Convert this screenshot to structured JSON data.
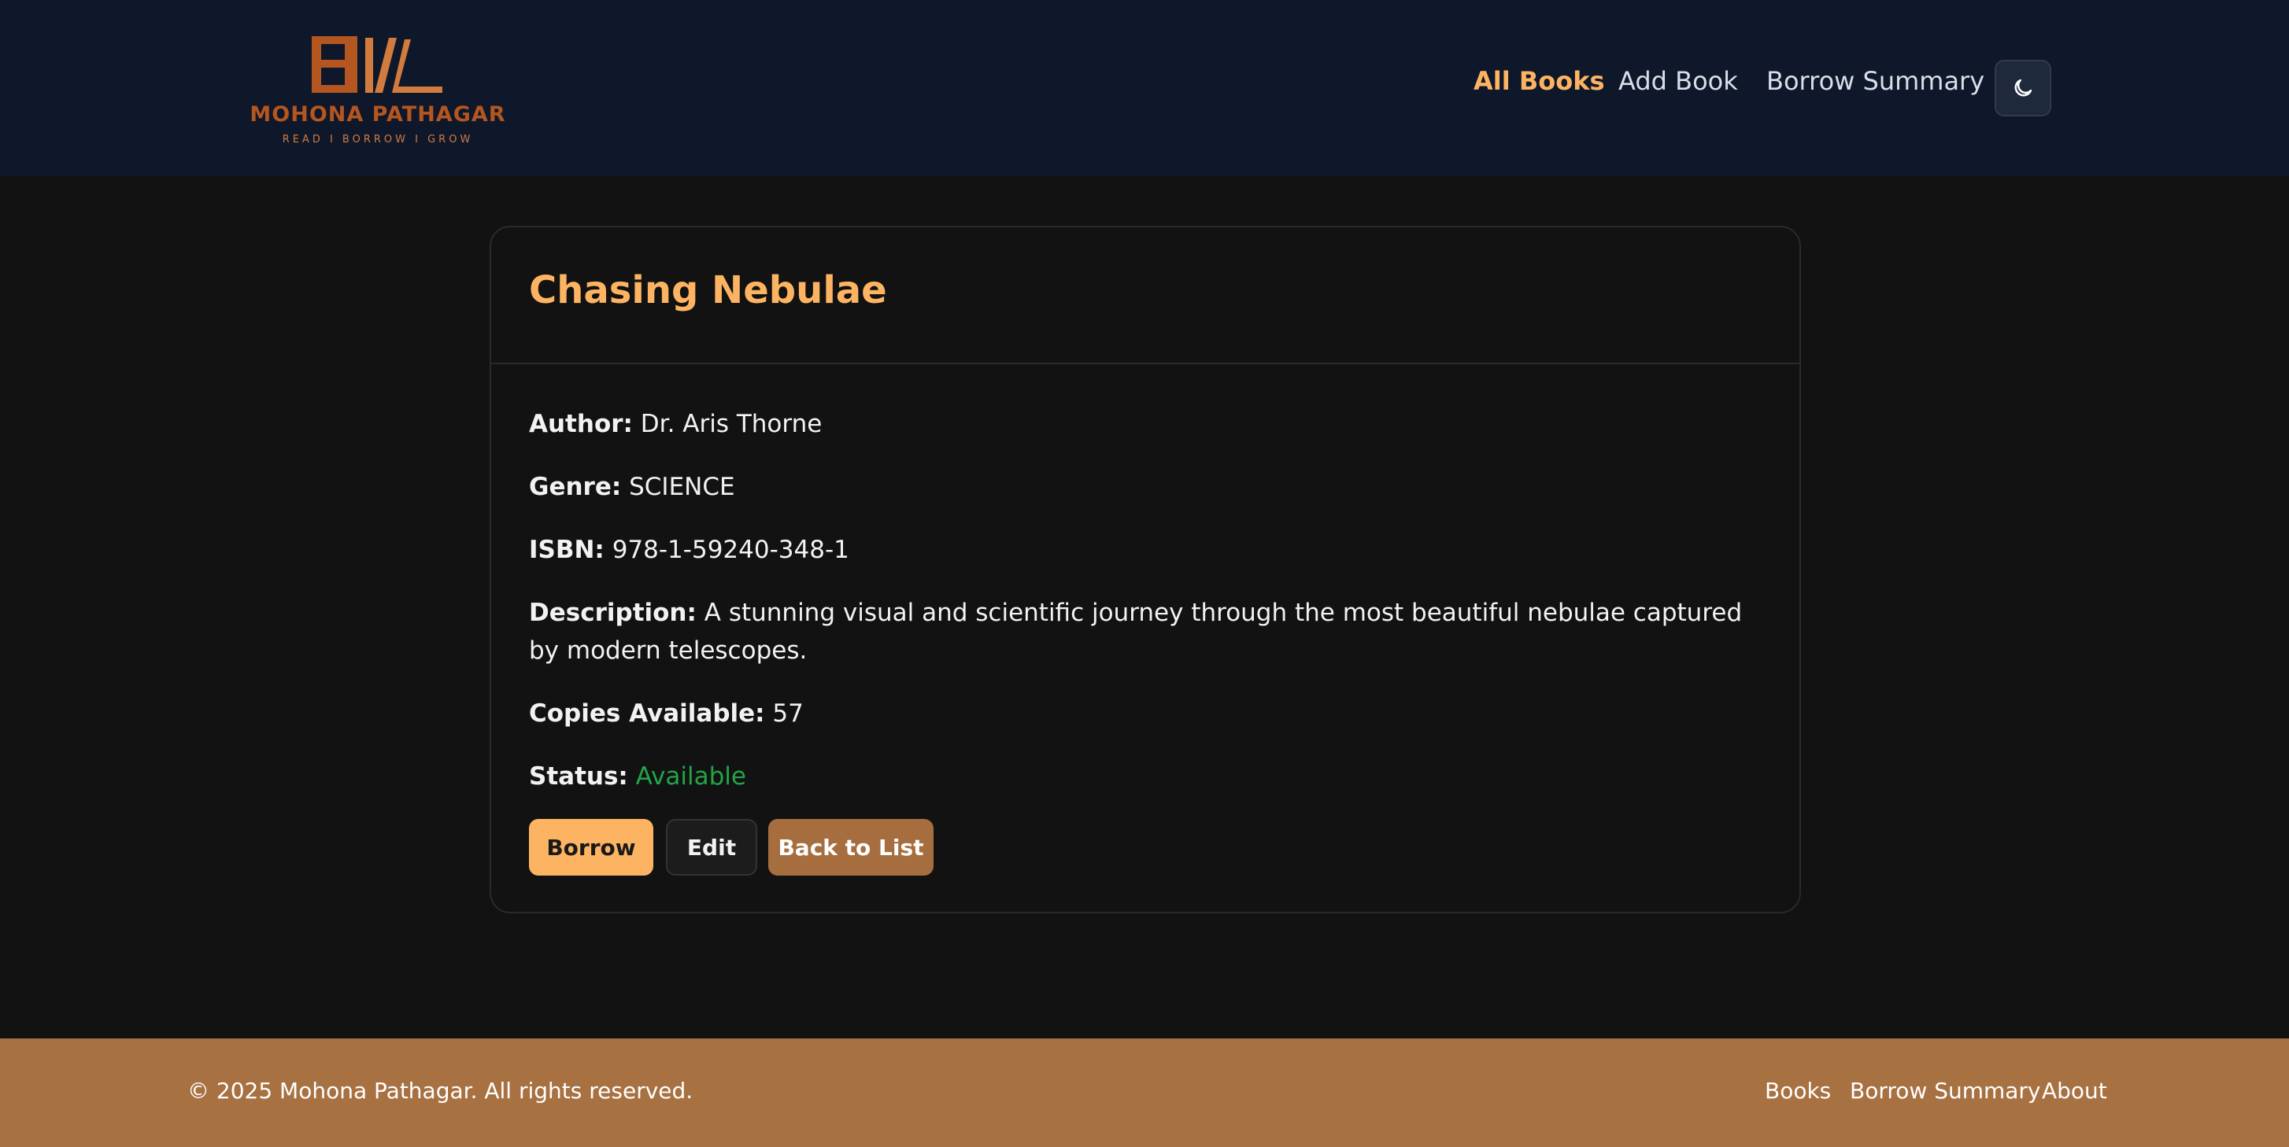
{
  "header": {
    "logo": {
      "title": "MOHONA PATHAGAR",
      "tagline": "READ I BORROW I GROW"
    },
    "nav": [
      {
        "label": "All Books",
        "active": true
      },
      {
        "label": "Add Book",
        "active": false
      },
      {
        "label": "Borrow Summary",
        "active": false
      }
    ],
    "theme_toggle_icon": "moon-icon"
  },
  "book": {
    "title": "Chasing Nebulae",
    "author_label": "Author:",
    "author": "Dr. Aris Thorne",
    "genre_label": "Genre:",
    "genre": "SCIENCE",
    "isbn_label": "ISBN:",
    "isbn": "978-1-59240-348-1",
    "description_label": "Description:",
    "description": "A stunning visual and scientific journey through the most beautiful nebulae captured by modern telescopes.",
    "copies_label": "Copies Available:",
    "copies": "57",
    "status_label": "Status:",
    "status": "Available"
  },
  "actions": {
    "borrow": "Borrow",
    "edit": "Edit",
    "back": "Back to List"
  },
  "footer": {
    "copyright": "© 2025 Mohona Pathagar. All rights reserved.",
    "links": [
      "Books",
      "Borrow Summary",
      "About"
    ]
  },
  "colors": {
    "accent": "#fdb462",
    "header_bg": "#0f172a",
    "footer_bg": "#a87142",
    "status_available": "#22a447"
  }
}
